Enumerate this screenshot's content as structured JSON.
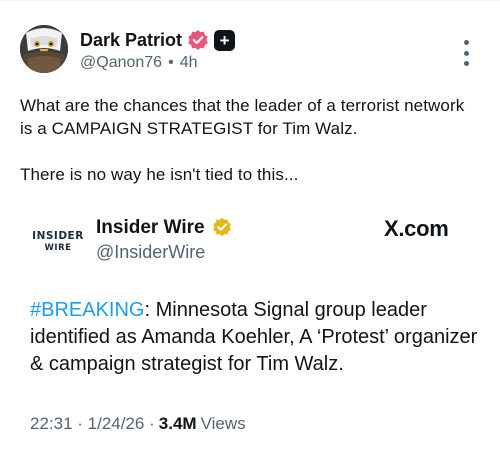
{
  "post": {
    "display_name": "Dark Patriot",
    "handle": "@Qanon76",
    "separator": "•",
    "time": "4h",
    "verified_icon": "verified-badge-icon",
    "plus_icon": "plus-badge-icon",
    "text_para1": "What are the chances that the leader of a terrorist network is a CAMPAIGN STRATEGIST for Tim Walz.",
    "text_para2": "There is no way he isn't tied to this..."
  },
  "embed": {
    "logo_line1": "INSIDER",
    "logo_line2": "WIRE",
    "display_name": "Insider Wire",
    "handle": "@InsiderWire",
    "source": "X.com",
    "hashtag": "#BREAKING",
    "text_rest": ": Minnesota Signal group leader identified as Amanda Koehler, A ‘Protest’ organizer & campaign strategist for Tim Walz.",
    "timestamp": "22:31 · 1/24/26 ·",
    "views_count": "3.4M",
    "views_label": "Views"
  },
  "colors": {
    "accent": "#1d9bf0",
    "verified_pink": "#e8547a",
    "verified_gold": "#e2b719",
    "secondary_text": "#536471"
  }
}
